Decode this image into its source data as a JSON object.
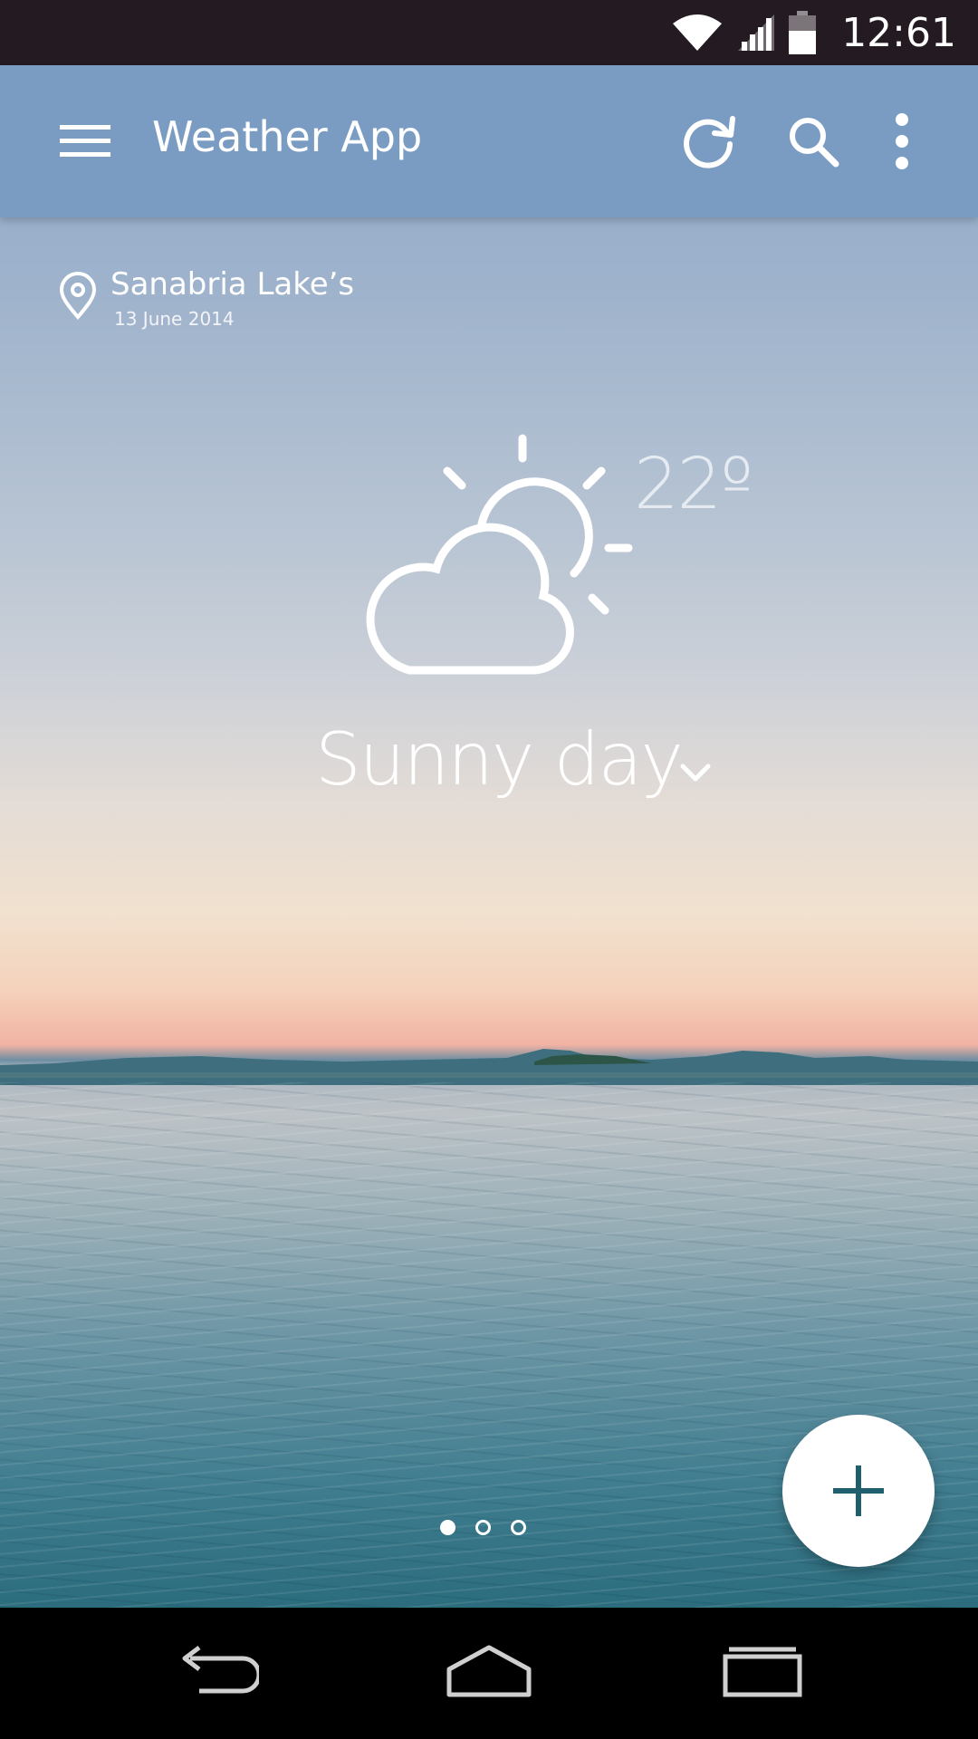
{
  "status_bar": {
    "time": "12:61",
    "icons": [
      "wifi-icon",
      "signal-icon",
      "battery-icon"
    ]
  },
  "app_bar": {
    "title": "Weather App",
    "actions": [
      "refresh-icon",
      "search-icon",
      "more-vert-icon"
    ],
    "menu_icon": "menu-icon",
    "background": "#7a9cc3"
  },
  "location": {
    "name": "Sanabria Lake’s",
    "date": "13 June 2014",
    "icon": "location-pin-icon"
  },
  "weather": {
    "icon": "partly-cloudy-icon",
    "temperature": "22º",
    "condition": "Sunny day"
  },
  "pager": {
    "pages": 3,
    "current": 1
  },
  "fab": {
    "icon": "add-icon",
    "color": "#1f5f6e"
  },
  "nav_bar": {
    "buttons": [
      "back-icon",
      "home-icon",
      "recents-icon"
    ]
  }
}
